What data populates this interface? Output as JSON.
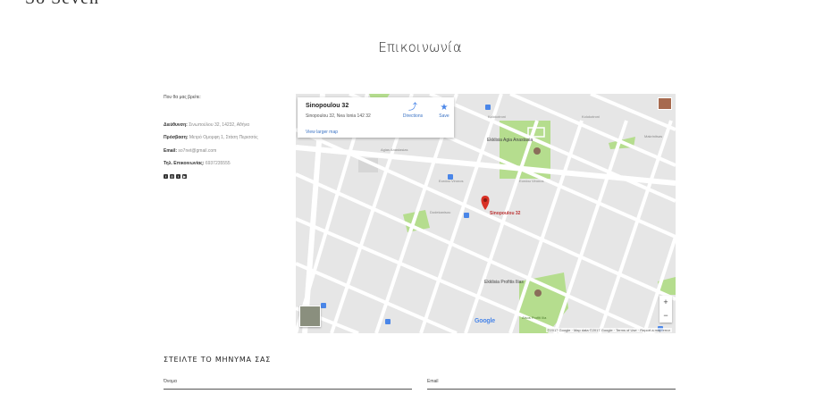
{
  "header": {
    "logo_text": "So Seven"
  },
  "page": {
    "title": "Επικοινωνία"
  },
  "contact": {
    "intro": "Που θα μας βρείτε:",
    "address_label": "Διεύθυνση:",
    "address_value": "Σινωπούλου 32, 14232, Αθήνα",
    "access_label": "Πρόσβαση:",
    "access_value": "Μετρό Ομορφη 1, Στάση Περισσός",
    "email_label": "Email:",
    "email_value": "so7net@gmail.com",
    "phone_label": "Τηλ. Επικοινωνίας:",
    "phone_value": "6937235555",
    "social_icons": [
      "facebook-icon",
      "instagram-icon",
      "twitter-icon",
      "youtube-icon"
    ]
  },
  "map": {
    "place_name": "Sinopoulou 32",
    "place_address": "Sinopoulou 32, Nea Ionia 142 32",
    "larger_map": "View larger map",
    "directions": "Directions",
    "save": "Save",
    "pin_label": "Sinopoulou 32",
    "poi_church1": "Ekklisia Agia Anastasia",
    "poi_church2": "Ekklisia Profitis Ilias",
    "park_label": "Alsos Profiti Ilia",
    "streets": [
      "Kolokotroni",
      "Agias Anastasias",
      "Eordou Vironos",
      "Dodekanisou",
      "Makrinitsas",
      "Kolokotroni",
      "Ikarou",
      "Eordou Vironos"
    ],
    "google_logo": "Google",
    "attribution": "©2017 Google · Map data ©2017 Google · Terms of Use · Report a map error",
    "zoom_in": "+",
    "zoom_out": "−",
    "colors": {
      "road": "#ffffff",
      "block": "#e6e6e6",
      "park": "#b5dd8e",
      "pin": "#d93025"
    }
  },
  "form": {
    "title": "ΣΤΕΙΛΤΕ ΤΟ ΜΗΝΥΜΑ ΣΑΣ",
    "name_label": "Όνομα",
    "email_label": "Email"
  }
}
